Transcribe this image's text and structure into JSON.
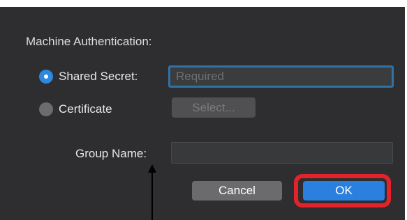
{
  "machine_auth": {
    "title": "Machine Authentication:",
    "shared_secret": {
      "label": "Shared Secret:",
      "selected": true,
      "placeholder": "Required",
      "value": ""
    },
    "certificate": {
      "label": "Certificate",
      "selected": false,
      "select_button_label": "Select..."
    }
  },
  "group": {
    "label": "Group Name:",
    "value": ""
  },
  "buttons": {
    "cancel_label": "Cancel",
    "ok_label": "OK"
  },
  "colors": {
    "dialog_background": "#2e2e30",
    "accent_blue": "#2b7fdf",
    "focus_ring": "#2f72a8",
    "highlight_red": "#e3222a"
  }
}
